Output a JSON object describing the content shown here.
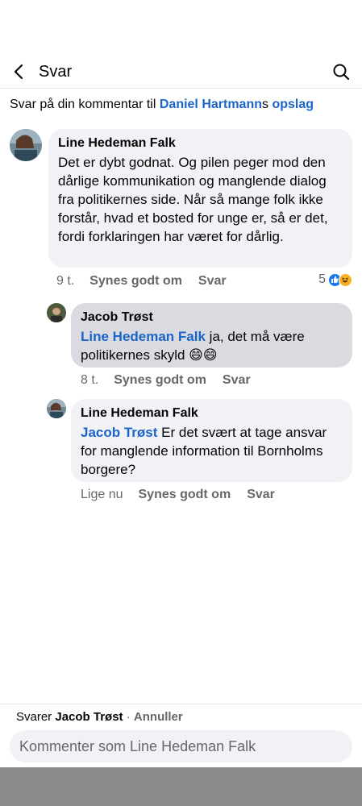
{
  "header": {
    "title": "Svar",
    "back_icon": "chevron-left-icon",
    "search_icon": "search-icon"
  },
  "context": {
    "prefix": "Svar på din kommentar til ",
    "owner_name": "Daniel Hartmann",
    "possessive": "s",
    "post_word": " opslag"
  },
  "comments": [
    {
      "author": "Line Hedeman Falk",
      "text": "Det er dybt godnat. Og pilen peger mod den dårlige kommunikation og manglende dialog fra politikernes side. Når så mange folk ikke forstår, hvad et bosted for unge er, så er det, fordi forklaringen har været for dårlig.",
      "time": "9 t.",
      "like_label": "Synes godt om",
      "reply_label": "Svar",
      "reaction_count": "5",
      "reaction_icons": [
        "like-icon",
        "haha-icon"
      ]
    },
    {
      "author": "Jacob Trøst",
      "mention": "Line Hedeman Falk",
      "text": " ja, det må være politikernes skyld 😄😄",
      "time": "8 t.",
      "like_label": "Synes godt om",
      "reply_label": "Svar"
    },
    {
      "author": "Line Hedeman Falk",
      "mention": "Jacob Trøst",
      "text": " Er det svært at tage ansvar for manglende information til Bornholms borgere?",
      "time": "Lige nu",
      "like_label": "Synes godt om",
      "reply_label": "Svar"
    }
  ],
  "composer": {
    "replying_prefix": "Svarer ",
    "replying_to": "Jacob Trøst",
    "separator": " · ",
    "cancel_label": "Annuller",
    "placeholder": "Kommenter som Line Hedeman Falk"
  },
  "colors": {
    "link": "#1b64c8",
    "bubble": "#f0f2f5",
    "bubble_highlight": "#d9dbe0",
    "meta_text": "#65676b"
  }
}
